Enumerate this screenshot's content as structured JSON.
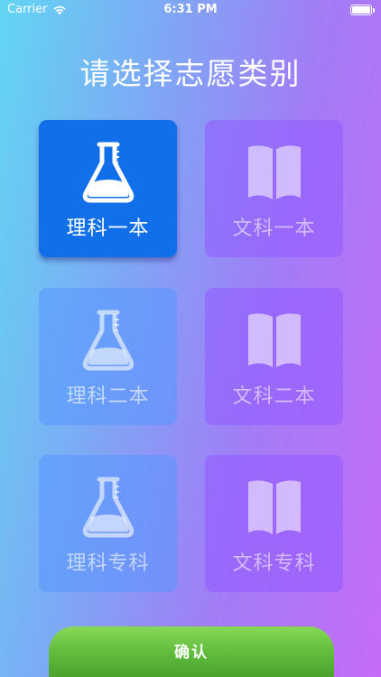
{
  "status_bar": {
    "carrier": "Carrier",
    "time": "6:31 PM"
  },
  "title": "请选择志愿类别",
  "options": [
    {
      "label": "理科一本",
      "icon": "flask-icon",
      "selected": true
    },
    {
      "label": "文科一本",
      "icon": "book-icon",
      "selected": false
    },
    {
      "label": "理科二本",
      "icon": "flask-icon",
      "selected": false
    },
    {
      "label": "文科二本",
      "icon": "book-icon",
      "selected": false
    },
    {
      "label": "理科专科",
      "icon": "flask-icon",
      "selected": false
    },
    {
      "label": "文科专科",
      "icon": "book-icon",
      "selected": false
    }
  ],
  "confirm_label": "确认",
  "colors": {
    "selected": "#1170e9",
    "confirm": "#5cb83a"
  }
}
